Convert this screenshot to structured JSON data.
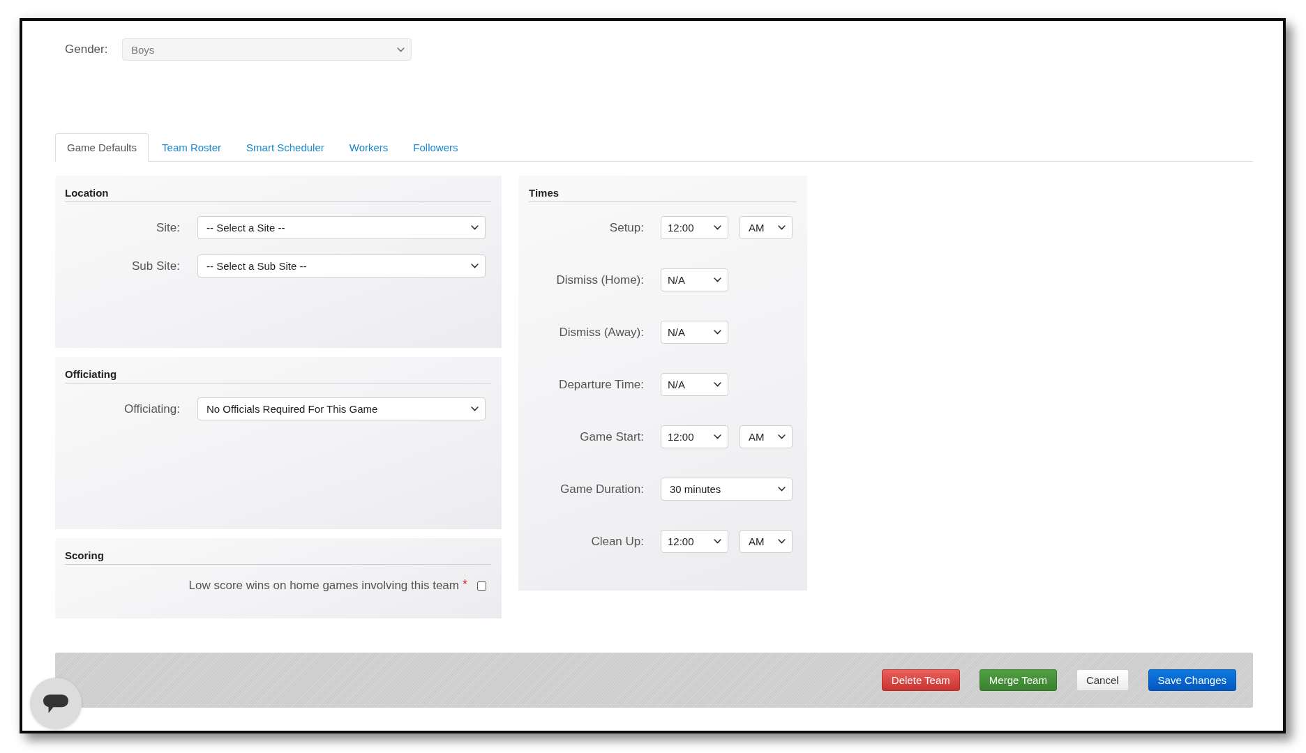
{
  "gender": {
    "label": "Gender:",
    "value": "Boys",
    "disabled": true
  },
  "tabs": [
    {
      "label": "Game Defaults",
      "selected": true
    },
    {
      "label": "Team Roster",
      "selected": false
    },
    {
      "label": "Smart Scheduler",
      "selected": false
    },
    {
      "label": "Workers",
      "selected": false
    },
    {
      "label": "Followers",
      "selected": false
    }
  ],
  "left_sections": [
    {
      "kind": "fields",
      "title": "Location",
      "fields": [
        {
          "label": "Site:",
          "value": "-- Select a Site --"
        },
        {
          "label": "Sub Site:",
          "value": "-- Select a Sub Site --"
        }
      ]
    },
    {
      "kind": "fields",
      "title": "Officiating",
      "fields": [
        {
          "label": "Officiating:",
          "value": "No Officials Required For This Game"
        }
      ]
    },
    {
      "kind": "checkbox",
      "title": "Scoring",
      "label": "Low score wins on home games involving this team",
      "required_mark": "*",
      "checked": false
    }
  ],
  "times": {
    "title": "Times",
    "rows": [
      {
        "kind": "clock",
        "label": "Setup:",
        "value": "12:00",
        "meridiem": "AM"
      },
      {
        "kind": "short",
        "label": "Dismiss (Home):",
        "value": "N/A"
      },
      {
        "kind": "short",
        "label": "Dismiss (Away):",
        "value": "N/A"
      },
      {
        "kind": "short",
        "label": "Departure Time:",
        "value": "N/A"
      },
      {
        "kind": "clock",
        "label": "Game Start:",
        "value": "12:00",
        "meridiem": "AM"
      },
      {
        "kind": "long",
        "label": "Game Duration:",
        "value": "30 minutes"
      },
      {
        "kind": "clock",
        "label": "Clean Up:",
        "value": "12:00",
        "meridiem": "AM"
      }
    ]
  },
  "actions": [
    {
      "kind": "delete",
      "label": "Delete Team"
    },
    {
      "kind": "merge",
      "label": "Merge Team"
    },
    {
      "kind": "cancel",
      "label": "Cancel"
    },
    {
      "kind": "save",
      "label": "Save Changes"
    }
  ]
}
